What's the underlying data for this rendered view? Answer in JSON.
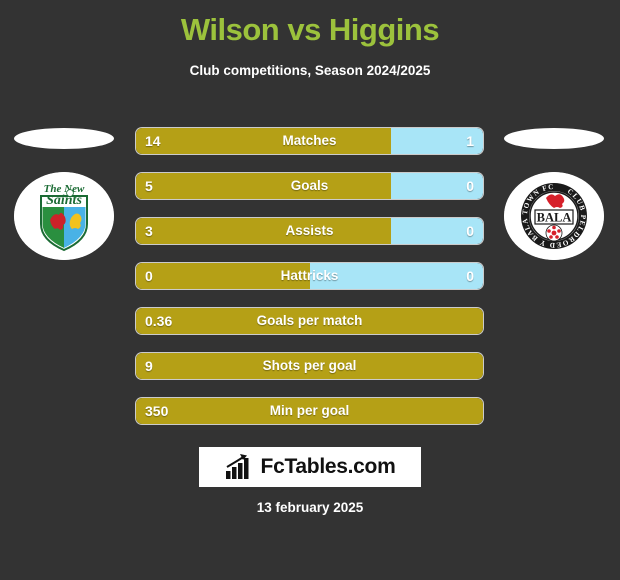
{
  "header": {
    "title": "Wilson vs Higgins",
    "subtitle": "Club competitions, Season 2024/2025",
    "title_color": "#9cc23c"
  },
  "colors": {
    "background": "#333333",
    "home_bar": "#b5a016",
    "away_bar": "#a8e5f7",
    "text": "#ffffff"
  },
  "teams": {
    "home": {
      "badge_name": "the-new-saints-badge",
      "badge_text": "The New Saints"
    },
    "away": {
      "badge_name": "bala-town-badge",
      "badge_text": "BALA",
      "badge_ring_text": "CLUB PELDROED Y BALA TOWN FC"
    }
  },
  "chart_data": {
    "type": "bar",
    "title": "Wilson vs Higgins",
    "subtitle": "Club competitions, Season 2024/2025",
    "orientation": "horizontal-paired",
    "series": [
      {
        "name": "Wilson",
        "color": "#b5a016"
      },
      {
        "name": "Higgins",
        "color": "#a8e5f7"
      }
    ],
    "categories": [
      "Matches",
      "Goals",
      "Assists",
      "Hattricks",
      "Goals per match",
      "Shots per goal",
      "Min per goal"
    ],
    "rows": [
      {
        "label": "Matches",
        "home": "14",
        "away": "1",
        "home_pct": 73.5,
        "away_pct": 26.5,
        "has_away": true
      },
      {
        "label": "Goals",
        "home": "5",
        "away": "0",
        "home_pct": 73.5,
        "away_pct": 26.5,
        "has_away": true
      },
      {
        "label": "Assists",
        "home": "3",
        "away": "0",
        "home_pct": 73.5,
        "away_pct": 26.5,
        "has_away": true
      },
      {
        "label": "Hattricks",
        "home": "0",
        "away": "0",
        "home_pct": 50,
        "away_pct": 50,
        "has_away": true
      },
      {
        "label": "Goals per match",
        "home": "0.36",
        "away": "",
        "home_pct": 100,
        "away_pct": 0,
        "has_away": false
      },
      {
        "label": "Shots per goal",
        "home": "9",
        "away": "",
        "home_pct": 100,
        "away_pct": 0,
        "has_away": false
      },
      {
        "label": "Min per goal",
        "home": "350",
        "away": "",
        "home_pct": 100,
        "away_pct": 0,
        "has_away": false
      }
    ]
  },
  "footer": {
    "logo_text": "FcTables.com",
    "logo_icon": "bar-chart-icon",
    "date": "13 february 2025"
  }
}
